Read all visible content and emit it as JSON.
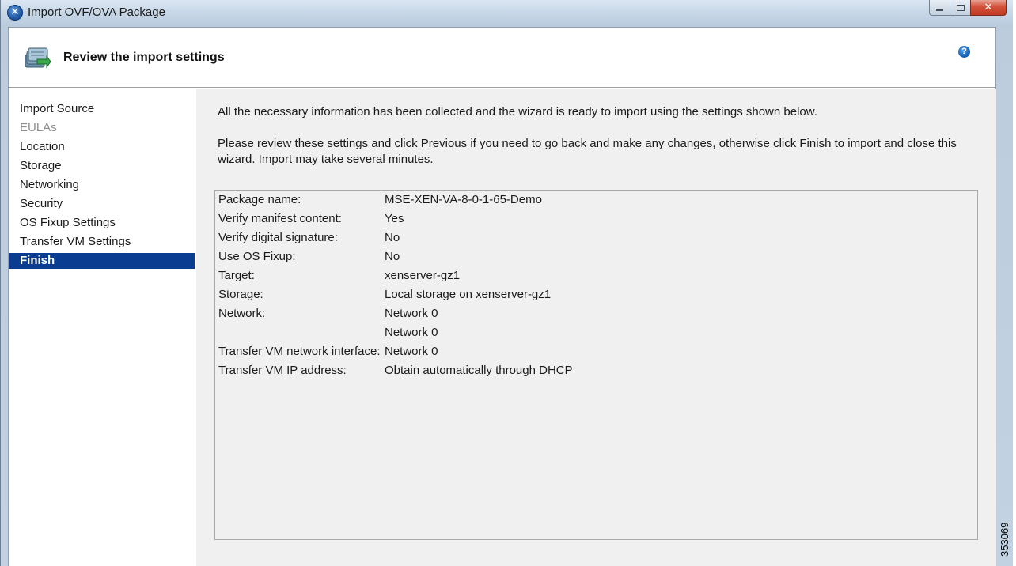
{
  "window": {
    "title": "Import OVF/OVA Package",
    "icon": "xencenter-x-icon",
    "buttons": {
      "minimize": "minimize-icon",
      "maximize": "maximize-icon",
      "close": "close-icon"
    }
  },
  "header": {
    "title": "Review the import settings",
    "icon": "import-package-icon",
    "help_icon": "help-icon",
    "help_glyph": "?"
  },
  "nav": {
    "items": [
      {
        "label": "Import Source",
        "state": "normal"
      },
      {
        "label": "EULAs",
        "state": "disabled"
      },
      {
        "label": "Location",
        "state": "normal"
      },
      {
        "label": "Storage",
        "state": "normal"
      },
      {
        "label": "Networking",
        "state": "normal"
      },
      {
        "label": "Security",
        "state": "normal"
      },
      {
        "label": "OS Fixup Settings",
        "state": "normal"
      },
      {
        "label": "Transfer VM Settings",
        "state": "normal"
      },
      {
        "label": "Finish",
        "state": "active"
      }
    ]
  },
  "content": {
    "intro": "All the necessary information has been collected and the wizard is ready to import using the settings shown below.",
    "instructions": "Please review these settings and click Previous if you need to go back and make any changes, otherwise click Finish to import and close this wizard.  Import may take several minutes."
  },
  "summary": {
    "rows": [
      {
        "key": "Package name:",
        "value": "MSE-XEN-VA-8-0-1-65-Demo"
      },
      {
        "key": "Verify manifest content:",
        "value": "Yes"
      },
      {
        "key": "Verify digital signature:",
        "value": "No"
      },
      {
        "key": "Use OS Fixup:",
        "value": "No"
      },
      {
        "key": "Target:",
        "value": "xenserver-gz1"
      },
      {
        "key": "Storage:",
        "value": "Local storage on xenserver-gz1"
      },
      {
        "key": "Network:",
        "value": "Network 0"
      },
      {
        "key": "",
        "value": "Network 0"
      },
      {
        "key": "Transfer VM network interface:",
        "value": "Network 0"
      },
      {
        "key": "Transfer VM IP address:",
        "value": "Obtain automatically through DHCP"
      }
    ]
  },
  "figure_id": "353069",
  "colors": {
    "selection": "#0a3d91",
    "content_bg": "#f0f0f0",
    "disabled_text": "#8d8d8d"
  }
}
